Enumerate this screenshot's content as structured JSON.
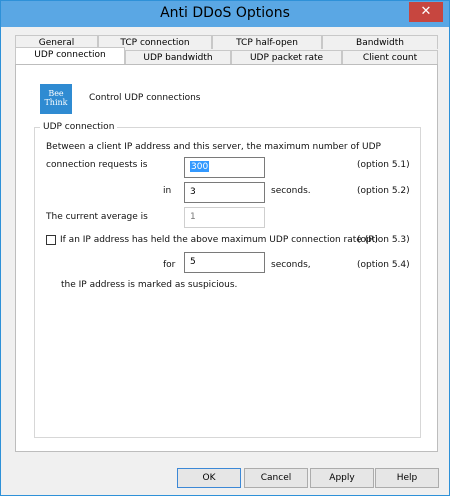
{
  "window": {
    "title": "Anti DDoS Options",
    "close_symbol": "✕"
  },
  "tabs": {
    "row1": [
      "General",
      "TCP connection",
      "TCP half-open",
      "Bandwidth"
    ],
    "row2": [
      "UDP connection",
      "UDP bandwidth",
      "UDP packet rate",
      "Client count"
    ]
  },
  "header": {
    "logo_text_line1": "Bee",
    "logo_text_line2": "Think",
    "description": "Control UDP connections"
  },
  "group": {
    "label": "UDP connection"
  },
  "content": {
    "line1": "Between a client IP address and this server, the maximum number of UDP",
    "line2": "connection requests is",
    "connection_requests_value": "300",
    "option_51": "(option 5.1)",
    "in_label": "in",
    "seconds_value": "3",
    "seconds_label": "seconds.",
    "option_52": "(option 5.2)",
    "current_average_label": "The current average is",
    "current_average_value": "1",
    "checkbox_label": "If an IP address has held the above maximum UDP connection rate (R)",
    "option_53": "(option 5.3)",
    "for_label": "for",
    "for_value": "5",
    "seconds_label2": "seconds,",
    "option_54": "(option 5.4)",
    "suspicious_text": "the IP address is marked as suspicious."
  },
  "buttons": {
    "ok": "OK",
    "cancel": "Cancel",
    "apply": "Apply",
    "help": "Help"
  }
}
